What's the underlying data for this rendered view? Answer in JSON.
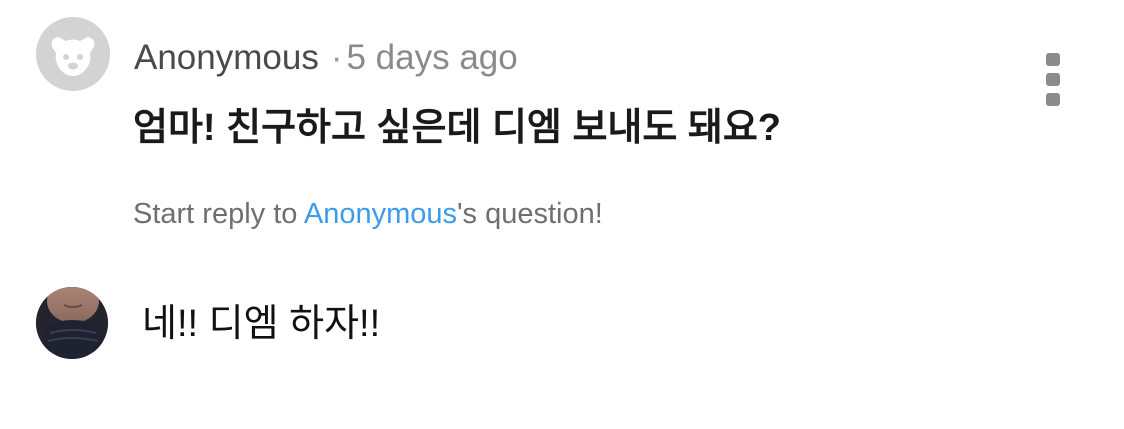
{
  "question": {
    "author": "Anonymous",
    "separator": "·",
    "time": "5 days ago",
    "text": "엄마! 친구하고 싶은데 디엠 보내도 돼요?",
    "avatar_icon": "anonymous-dog-icon",
    "menu_icon": "more-vertical-icon"
  },
  "reply_prompt": {
    "prefix": "Start reply to ",
    "author_link": "Anonymous",
    "suffix": "'s question!",
    "link_color": "#3d9bea"
  },
  "answer": {
    "text": "네!! 디엠 하자!!",
    "avatar_icon": "user-photo-avatar"
  }
}
